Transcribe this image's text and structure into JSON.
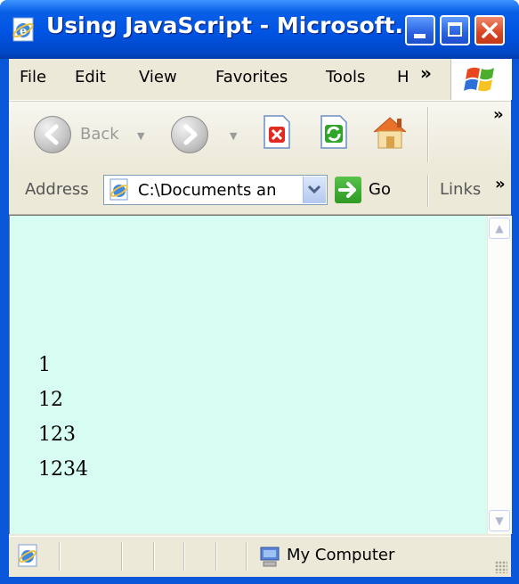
{
  "window": {
    "title": "Using JavaScript - Microsoft..."
  },
  "menu": {
    "items": [
      "File",
      "Edit",
      "View",
      "Favorites",
      "Tools",
      "H"
    ],
    "overflow": "»"
  },
  "toolbar": {
    "back_label": "Back",
    "overflow": "»"
  },
  "address": {
    "label": "Address",
    "value": "C:\\Documents an",
    "go_label": "Go",
    "links_label": "Links",
    "overflow": "»"
  },
  "content": {
    "background": "#d7fcf2",
    "lines": [
      "1",
      "12",
      "123",
      "1234"
    ]
  },
  "status": {
    "zone": "My Computer"
  },
  "colors": {
    "titlebar": "#0054e3",
    "close_button": "#d84622"
  }
}
